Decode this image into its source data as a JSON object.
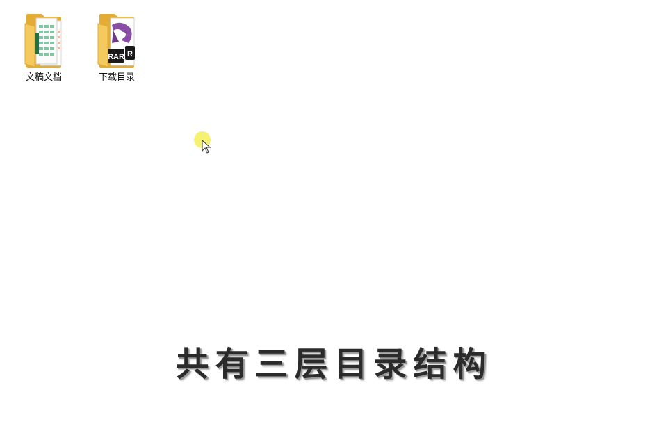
{
  "desktop": {
    "icons": [
      {
        "label": "文稿文档",
        "icon": "folder-spreadsheet-icon"
      },
      {
        "label": "下载目录",
        "icon": "folder-winrar-icon"
      }
    ]
  },
  "caption": {
    "text": "共有三层目录结构"
  },
  "colors": {
    "folder": "#f4c95d",
    "folder_dark": "#e2ac35",
    "excel_green": "#1e7145",
    "rar_purple": "#8a4da6",
    "cursor_highlight": "#f3f05a",
    "caption_text": "#2b2b2b"
  }
}
